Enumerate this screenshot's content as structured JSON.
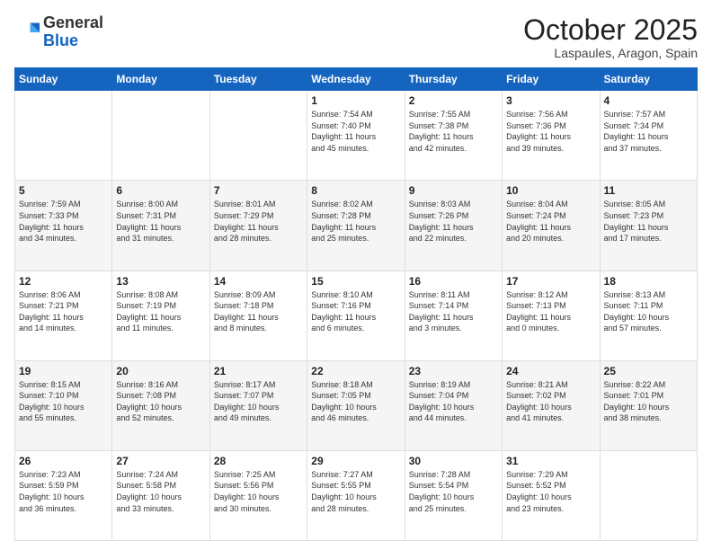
{
  "header": {
    "logo_general": "General",
    "logo_blue": "Blue",
    "month_title": "October 2025",
    "location": "Laspaules, Aragon, Spain"
  },
  "days_of_week": [
    "Sunday",
    "Monday",
    "Tuesday",
    "Wednesday",
    "Thursday",
    "Friday",
    "Saturday"
  ],
  "weeks": [
    [
      {
        "day": "",
        "info": ""
      },
      {
        "day": "",
        "info": ""
      },
      {
        "day": "",
        "info": ""
      },
      {
        "day": "1",
        "info": "Sunrise: 7:54 AM\nSunset: 7:40 PM\nDaylight: 11 hours\nand 45 minutes."
      },
      {
        "day": "2",
        "info": "Sunrise: 7:55 AM\nSunset: 7:38 PM\nDaylight: 11 hours\nand 42 minutes."
      },
      {
        "day": "3",
        "info": "Sunrise: 7:56 AM\nSunset: 7:36 PM\nDaylight: 11 hours\nand 39 minutes."
      },
      {
        "day": "4",
        "info": "Sunrise: 7:57 AM\nSunset: 7:34 PM\nDaylight: 11 hours\nand 37 minutes."
      }
    ],
    [
      {
        "day": "5",
        "info": "Sunrise: 7:59 AM\nSunset: 7:33 PM\nDaylight: 11 hours\nand 34 minutes."
      },
      {
        "day": "6",
        "info": "Sunrise: 8:00 AM\nSunset: 7:31 PM\nDaylight: 11 hours\nand 31 minutes."
      },
      {
        "day": "7",
        "info": "Sunrise: 8:01 AM\nSunset: 7:29 PM\nDaylight: 11 hours\nand 28 minutes."
      },
      {
        "day": "8",
        "info": "Sunrise: 8:02 AM\nSunset: 7:28 PM\nDaylight: 11 hours\nand 25 minutes."
      },
      {
        "day": "9",
        "info": "Sunrise: 8:03 AM\nSunset: 7:26 PM\nDaylight: 11 hours\nand 22 minutes."
      },
      {
        "day": "10",
        "info": "Sunrise: 8:04 AM\nSunset: 7:24 PM\nDaylight: 11 hours\nand 20 minutes."
      },
      {
        "day": "11",
        "info": "Sunrise: 8:05 AM\nSunset: 7:23 PM\nDaylight: 11 hours\nand 17 minutes."
      }
    ],
    [
      {
        "day": "12",
        "info": "Sunrise: 8:06 AM\nSunset: 7:21 PM\nDaylight: 11 hours\nand 14 minutes."
      },
      {
        "day": "13",
        "info": "Sunrise: 8:08 AM\nSunset: 7:19 PM\nDaylight: 11 hours\nand 11 minutes."
      },
      {
        "day": "14",
        "info": "Sunrise: 8:09 AM\nSunset: 7:18 PM\nDaylight: 11 hours\nand 8 minutes."
      },
      {
        "day": "15",
        "info": "Sunrise: 8:10 AM\nSunset: 7:16 PM\nDaylight: 11 hours\nand 6 minutes."
      },
      {
        "day": "16",
        "info": "Sunrise: 8:11 AM\nSunset: 7:14 PM\nDaylight: 11 hours\nand 3 minutes."
      },
      {
        "day": "17",
        "info": "Sunrise: 8:12 AM\nSunset: 7:13 PM\nDaylight: 11 hours\nand 0 minutes."
      },
      {
        "day": "18",
        "info": "Sunrise: 8:13 AM\nSunset: 7:11 PM\nDaylight: 10 hours\nand 57 minutes."
      }
    ],
    [
      {
        "day": "19",
        "info": "Sunrise: 8:15 AM\nSunset: 7:10 PM\nDaylight: 10 hours\nand 55 minutes."
      },
      {
        "day": "20",
        "info": "Sunrise: 8:16 AM\nSunset: 7:08 PM\nDaylight: 10 hours\nand 52 minutes."
      },
      {
        "day": "21",
        "info": "Sunrise: 8:17 AM\nSunset: 7:07 PM\nDaylight: 10 hours\nand 49 minutes."
      },
      {
        "day": "22",
        "info": "Sunrise: 8:18 AM\nSunset: 7:05 PM\nDaylight: 10 hours\nand 46 minutes."
      },
      {
        "day": "23",
        "info": "Sunrise: 8:19 AM\nSunset: 7:04 PM\nDaylight: 10 hours\nand 44 minutes."
      },
      {
        "day": "24",
        "info": "Sunrise: 8:21 AM\nSunset: 7:02 PM\nDaylight: 10 hours\nand 41 minutes."
      },
      {
        "day": "25",
        "info": "Sunrise: 8:22 AM\nSunset: 7:01 PM\nDaylight: 10 hours\nand 38 minutes."
      }
    ],
    [
      {
        "day": "26",
        "info": "Sunrise: 7:23 AM\nSunset: 5:59 PM\nDaylight: 10 hours\nand 36 minutes."
      },
      {
        "day": "27",
        "info": "Sunrise: 7:24 AM\nSunset: 5:58 PM\nDaylight: 10 hours\nand 33 minutes."
      },
      {
        "day": "28",
        "info": "Sunrise: 7:25 AM\nSunset: 5:56 PM\nDaylight: 10 hours\nand 30 minutes."
      },
      {
        "day": "29",
        "info": "Sunrise: 7:27 AM\nSunset: 5:55 PM\nDaylight: 10 hours\nand 28 minutes."
      },
      {
        "day": "30",
        "info": "Sunrise: 7:28 AM\nSunset: 5:54 PM\nDaylight: 10 hours\nand 25 minutes."
      },
      {
        "day": "31",
        "info": "Sunrise: 7:29 AM\nSunset: 5:52 PM\nDaylight: 10 hours\nand 23 minutes."
      },
      {
        "day": "",
        "info": ""
      }
    ]
  ]
}
